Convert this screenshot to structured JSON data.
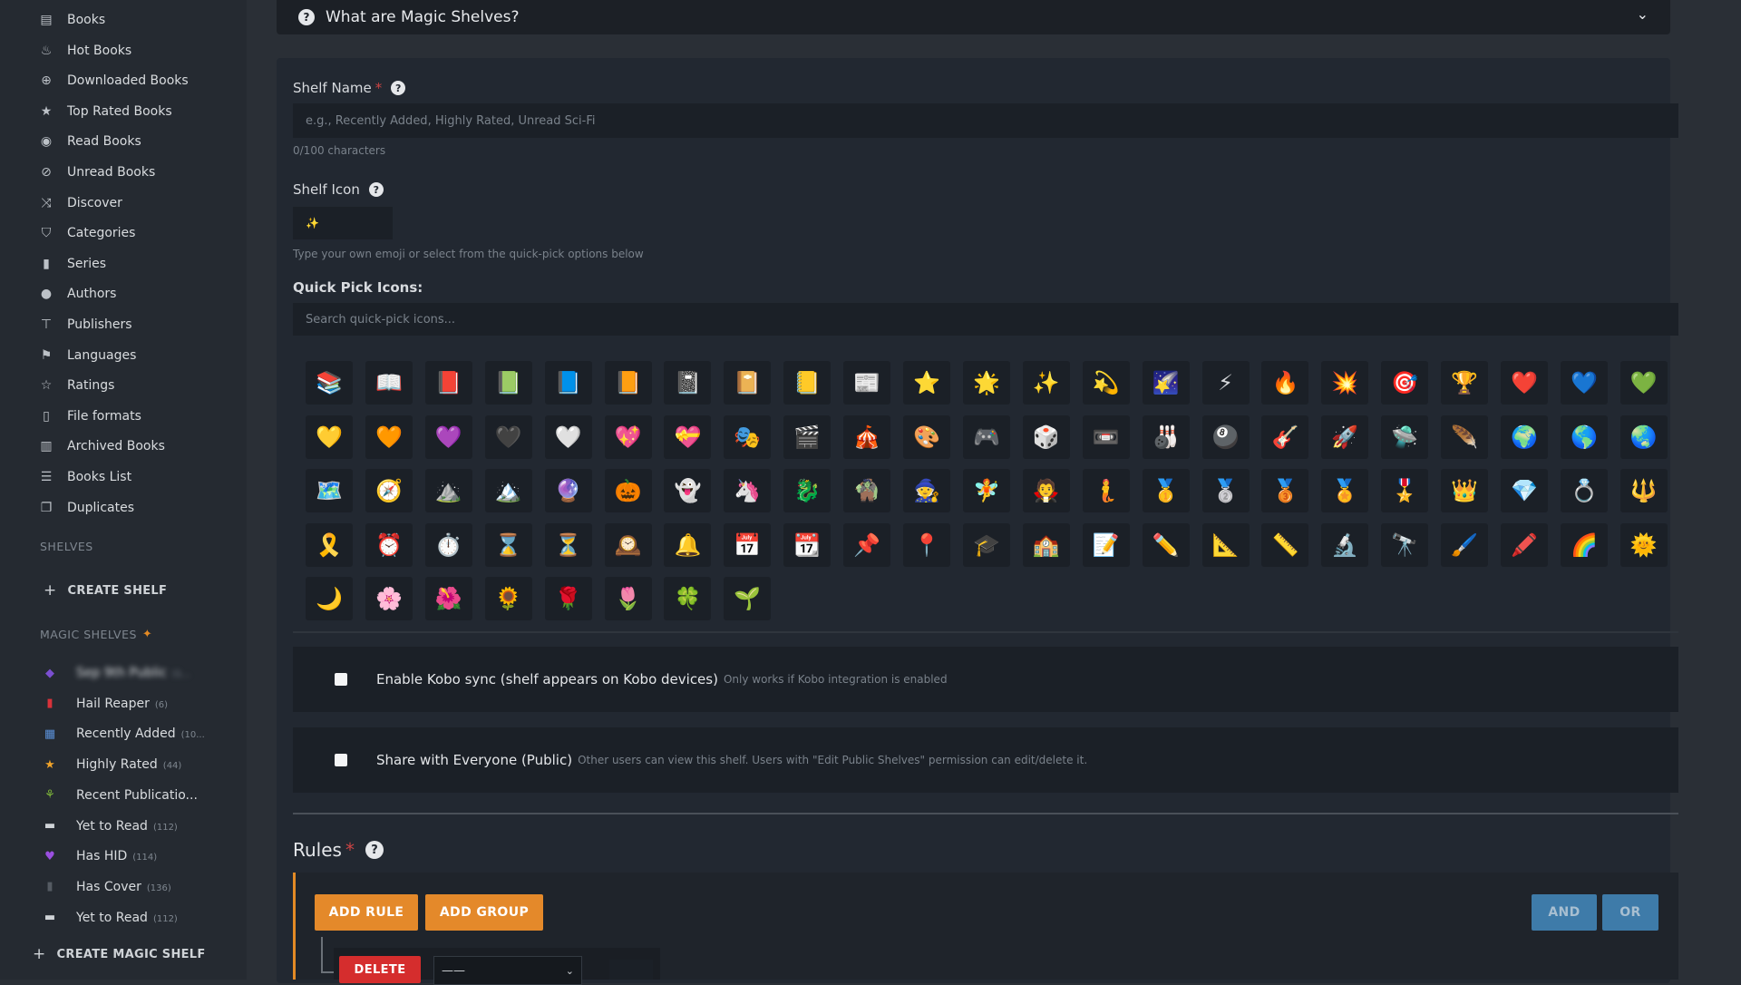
{
  "sidebar": {
    "nav": [
      {
        "label": "Books",
        "icon": "book-icon",
        "glyph": "▤"
      },
      {
        "label": "Hot Books",
        "icon": "fire-icon",
        "glyph": "♨"
      },
      {
        "label": "Downloaded Books",
        "icon": "download-icon",
        "glyph": "⊕"
      },
      {
        "label": "Top Rated Books",
        "icon": "star-icon",
        "glyph": "★"
      },
      {
        "label": "Read Books",
        "icon": "eye-icon",
        "glyph": "◉"
      },
      {
        "label": "Unread Books",
        "icon": "eye-slash-icon",
        "glyph": "⊘"
      },
      {
        "label": "Discover",
        "icon": "shuffle-icon",
        "glyph": "⤨"
      },
      {
        "label": "Categories",
        "icon": "tags-icon",
        "glyph": "⛉"
      },
      {
        "label": "Series",
        "icon": "bookmark-icon",
        "glyph": "▮"
      },
      {
        "label": "Authors",
        "icon": "user-icon",
        "glyph": "●"
      },
      {
        "label": "Publishers",
        "icon": "publisher-icon",
        "glyph": "⊤"
      },
      {
        "label": "Languages",
        "icon": "flag-icon",
        "glyph": "⚑"
      },
      {
        "label": "Ratings",
        "icon": "star-outline-icon",
        "glyph": "☆"
      },
      {
        "label": "File formats",
        "icon": "file-icon",
        "glyph": "▯"
      },
      {
        "label": "Archived Books",
        "icon": "archive-icon",
        "glyph": "▥"
      },
      {
        "label": "Books List",
        "icon": "list-icon",
        "glyph": "☰"
      },
      {
        "label": "Duplicates",
        "icon": "duplicates-icon",
        "glyph": "❐"
      }
    ],
    "shelves_label": "SHELVES",
    "create_shelf": "CREATE SHELF",
    "magic_shelves_label": "MAGIC SHELVES",
    "magic_items": [
      {
        "label": "Sep 9th Public",
        "count": "(1...",
        "glyph": "◆",
        "color": "#7b4fd0",
        "blurred": true
      },
      {
        "label": "Hail Reaper",
        "count": "(6)",
        "glyph": "▮",
        "color": "#d9323a",
        "blurred": false
      },
      {
        "label": "Recently Added",
        "count": "(10...",
        "glyph": "▦",
        "color": "#5a8fd6",
        "blurred": false
      },
      {
        "label": "Highly Rated",
        "count": "(44)",
        "glyph": "★",
        "color": "#f0a32a",
        "blurred": false
      },
      {
        "label": "Recent Publicatio...",
        "count": "",
        "glyph": "⚘",
        "color": "#7fb83a",
        "blurred": false
      },
      {
        "label": "Yet to Read",
        "count": "(112)",
        "glyph": "▬",
        "color": "#cfd3d7",
        "blurred": false
      },
      {
        "label": "Has HID",
        "count": "(114)",
        "glyph": "♥",
        "color": "#9a4fe0",
        "blurred": false
      },
      {
        "label": "Has Cover",
        "count": "(136)",
        "glyph": "▮",
        "color": "#555b63",
        "blurred": false
      },
      {
        "label": "Yet to Read",
        "count": "(112)",
        "glyph": "▬",
        "color": "#cfd3d7",
        "blurred": false
      }
    ],
    "create_magic_shelf": "CREATE MAGIC SHELF"
  },
  "faq": {
    "title": "What are Magic Shelves?"
  },
  "form": {
    "shelf_name_label": "Shelf Name",
    "shelf_name_placeholder": "e.g., Recently Added, Highly Rated, Unread Sci-Fi",
    "char_count": "0/100 characters",
    "shelf_icon_label": "Shelf Icon",
    "shelf_icon_value": "✨",
    "icon_hint": "Type your own emoji or select from the quick-pick options below",
    "quick_pick_label": "Quick Pick Icons:",
    "quick_pick_search_placeholder": "Search quick-pick icons...",
    "icons": [
      "📚",
      "📖",
      "📕",
      "📗",
      "📘",
      "📙",
      "📓",
      "📔",
      "📒",
      "📰",
      "⭐",
      "🌟",
      "✨",
      "💫",
      "🌠",
      "⚡",
      "🔥",
      "💥",
      "🎯",
      "🏆",
      "❤️",
      "💙",
      "💚",
      "💛",
      "🧡",
      "💜",
      "🖤",
      "🤍",
      "💖",
      "💝",
      "🎭",
      "🎬",
      "🎪",
      "🎨",
      "🎮",
      "🎲",
      "📼",
      "🎳",
      "🎱",
      "🎸",
      "🚀",
      "🛸",
      "🪶",
      "🌍",
      "🌎",
      "🌏",
      "🗺️",
      "🧭",
      "⛰️",
      "🏔️",
      "🔮",
      "🎃",
      "👻",
      "🦄",
      "🐉",
      "🧌",
      "🧙",
      "🧚",
      "🧛",
      "🧜",
      "🥇",
      "🥈",
      "🥉",
      "🏅",
      "🎖️",
      "👑",
      "💎",
      "💍",
      "🔱",
      "🎗️",
      "⏰",
      "⏱️",
      "⌛",
      "⏳",
      "🕰️",
      "🔔",
      "📅",
      "📆",
      "📌",
      "📍",
      "🎓",
      "🏫",
      "📝",
      "✏️",
      "📐",
      "📏",
      "🔬",
      "🔭",
      "🖌️",
      "🖍️",
      "🌈",
      "🌞",
      "🌙",
      "🌸",
      "🌺",
      "🌻",
      "🌹",
      "🌷",
      "🍀",
      "🌱"
    ],
    "kobo_label": "Enable Kobo sync (shelf appears on Kobo devices)",
    "kobo_hint": "Only works if Kobo integration is enabled",
    "public_label": "Share with Everyone (Public)",
    "public_hint": "Other users can view this shelf. Users with \"Edit Public Shelves\" permission can edit/delete it.",
    "rules_label": "Rules",
    "add_rule": "ADD RULE",
    "add_group": "ADD GROUP",
    "and": "AND",
    "or": "OR",
    "delete": "DELETE",
    "select_value": "——"
  }
}
